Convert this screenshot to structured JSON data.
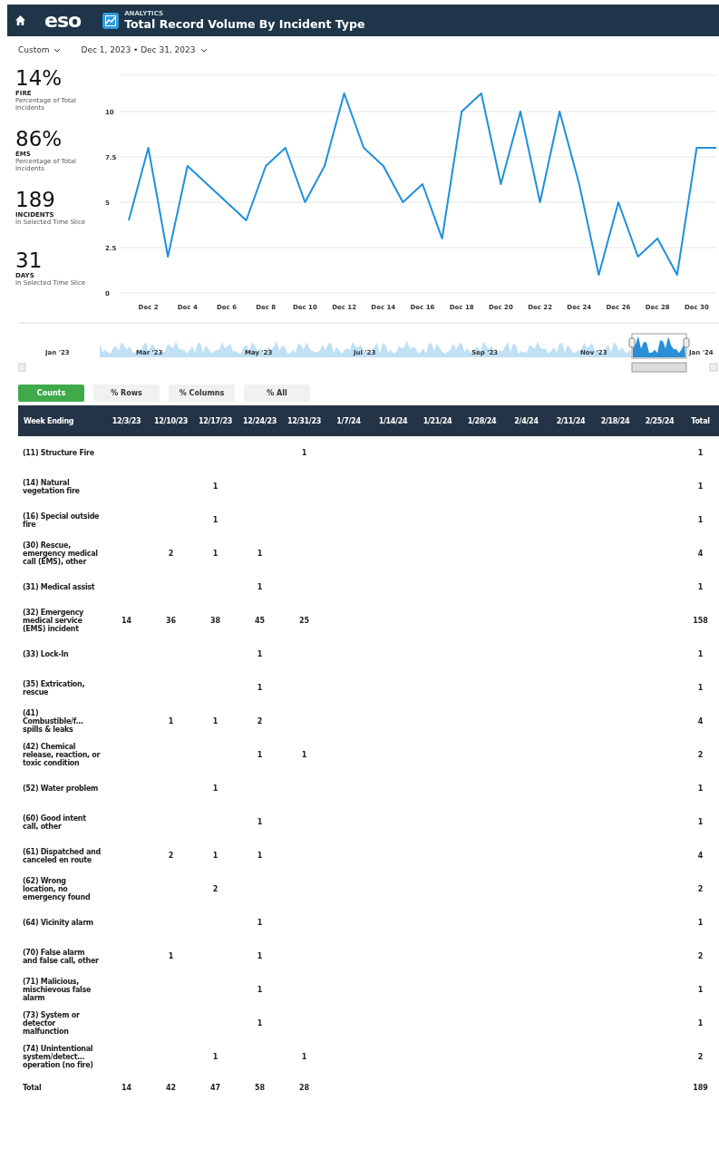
{
  "header": {
    "logo": "eso",
    "section": "ANALYTICS",
    "title": "Total Record Volume By Incident Type"
  },
  "filters": [
    {
      "label": "Custom"
    },
    {
      "label": "Dec 1, 2023 • Dec 31, 2023"
    }
  ],
  "stats": [
    {
      "value": "14%",
      "label": "FIRE",
      "sublabel": "Percentage of Total Incidents"
    },
    {
      "value": "86%",
      "label": "EMS",
      "sublabel": "Percentage of Total Incidents"
    },
    {
      "value": "189",
      "label": "INCIDENTS",
      "sublabel": "In Selected Time Slice"
    },
    {
      "value": "31",
      "label": "DAYS",
      "sublabel": "In Selected Time Slice"
    }
  ],
  "chart_data": {
    "type": "line",
    "grid": true,
    "categories": [
      null,
      "Dec 2",
      null,
      "Dec 4",
      null,
      "Dec 6",
      null,
      "Dec 8",
      null,
      "Dec 10",
      null,
      "Dec 12",
      null,
      "Dec 14",
      null,
      "Dec 16",
      null,
      "Dec 18",
      null,
      "Dec 20",
      null,
      "Dec 22",
      null,
      "Dec 24",
      null,
      "Dec 26",
      null,
      "Dec 28",
      null,
      "Dec 30",
      null
    ],
    "series": [
      {
        "color": "#1e90dc",
        "values": [
          4,
          8,
          2,
          7,
          6,
          5,
          4,
          7,
          8,
          5,
          7,
          11,
          8,
          7,
          5,
          6,
          3,
          10,
          11,
          6,
          10,
          5,
          10,
          6,
          1,
          5,
          2,
          3,
          1,
          8,
          8
        ]
      }
    ],
    "ylim": [
      0,
      12
    ],
    "yticks": [
      0,
      2.5,
      5,
      7.5,
      10
    ]
  },
  "navigator": {
    "labels": [
      "Jan '23",
      "Mar '23",
      "May '23",
      "Jul '23",
      "Sep '23",
      "Nov '23",
      "Jan '24"
    ]
  },
  "view_buttons": [
    {
      "label": "Counts",
      "selected": true
    },
    {
      "label": "% Rows",
      "selected": false
    },
    {
      "label": "% Columns",
      "selected": false
    },
    {
      "label": "% All",
      "selected": false
    }
  ],
  "table": {
    "columns": [
      "Week Ending",
      "12/3/23",
      "12/10/23",
      "12/17/23",
      "12/24/23",
      "12/31/23",
      "1/7/24",
      "1/14/24",
      "1/21/24",
      "1/28/24",
      "2/4/24",
      "2/11/24",
      "2/18/24",
      "2/25/24",
      "Total"
    ],
    "rows": [
      [
        "(11) Structure Fire",
        "",
        "",
        "",
        "",
        "1",
        "",
        "",
        "",
        "",
        "",
        "",
        "",
        "",
        "1"
      ],
      [
        "(14) Natural vegetation fire",
        "",
        "",
        "1",
        "",
        "",
        "",
        "",
        "",
        "",
        "",
        "",
        "",
        "",
        "1"
      ],
      [
        "(16) Special outside fire",
        "",
        "",
        "1",
        "",
        "",
        "",
        "",
        "",
        "",
        "",
        "",
        "",
        "",
        "1"
      ],
      [
        "(30) Rescue, emergency medical call (EMS), other",
        "",
        "2",
        "1",
        "1",
        "",
        "",
        "",
        "",
        "",
        "",
        "",
        "",
        "",
        "4"
      ],
      [
        "(31) Medical assist",
        "",
        "",
        "",
        "1",
        "",
        "",
        "",
        "",
        "",
        "",
        "",
        "",
        "",
        "1"
      ],
      [
        "(32) Emergency medical service (EMS) incident",
        "14",
        "36",
        "38",
        "45",
        "25",
        "",
        "",
        "",
        "",
        "",
        "",
        "",
        "",
        "158"
      ],
      [
        "(33) Lock-In",
        "",
        "",
        "",
        "1",
        "",
        "",
        "",
        "",
        "",
        "",
        "",
        "",
        "",
        "1"
      ],
      [
        "(35) Extrication, rescue",
        "",
        "",
        "",
        "1",
        "",
        "",
        "",
        "",
        "",
        "",
        "",
        "",
        "",
        "1"
      ],
      [
        "(41) Combustible/f… spills & leaks",
        "",
        "1",
        "1",
        "2",
        "",
        "",
        "",
        "",
        "",
        "",
        "",
        "",
        "",
        "4"
      ],
      [
        "(42) Chemical release, reaction, or toxic condition",
        "",
        "",
        "",
        "1",
        "1",
        "",
        "",
        "",
        "",
        "",
        "",
        "",
        "",
        "2"
      ],
      [
        "(52) Water problem",
        "",
        "",
        "1",
        "",
        "",
        "",
        "",
        "",
        "",
        "",
        "",
        "",
        "",
        "1"
      ],
      [
        "(60) Good intent call, other",
        "",
        "",
        "",
        "1",
        "",
        "",
        "",
        "",
        "",
        "",
        "",
        "",
        "",
        "1"
      ],
      [
        "(61) Dispatched and canceled en route",
        "",
        "2",
        "1",
        "1",
        "",
        "",
        "",
        "",
        "",
        "",
        "",
        "",
        "",
        "4"
      ],
      [
        "(62) Wrong location, no emergency found",
        "",
        "",
        "2",
        "",
        "",
        "",
        "",
        "",
        "",
        "",
        "",
        "",
        "",
        "2"
      ],
      [
        "(64) Vicinity alarm",
        "",
        "",
        "",
        "1",
        "",
        "",
        "",
        "",
        "",
        "",
        "",
        "",
        "",
        "1"
      ],
      [
        "(70) False alarm and false call, other",
        "",
        "1",
        "",
        "1",
        "",
        "",
        "",
        "",
        "",
        "",
        "",
        "",
        "",
        "2"
      ],
      [
        "(71) Malicious, mischievous false alarm",
        "",
        "",
        "",
        "1",
        "",
        "",
        "",
        "",
        "",
        "",
        "",
        "",
        "",
        "1"
      ],
      [
        "(73) System or detector malfunction",
        "",
        "",
        "",
        "1",
        "",
        "",
        "",
        "",
        "",
        "",
        "",
        "",
        "",
        "1"
      ],
      [
        "(74) Unintentional system/detect… operation (no fire)",
        "",
        "",
        "1",
        "",
        "1",
        "",
        "",
        "",
        "",
        "",
        "",
        "",
        "",
        "2"
      ],
      [
        "Total",
        "14",
        "42",
        "47",
        "58",
        "28",
        "",
        "",
        "",
        "",
        "",
        "",
        "",
        "",
        "189"
      ]
    ]
  }
}
